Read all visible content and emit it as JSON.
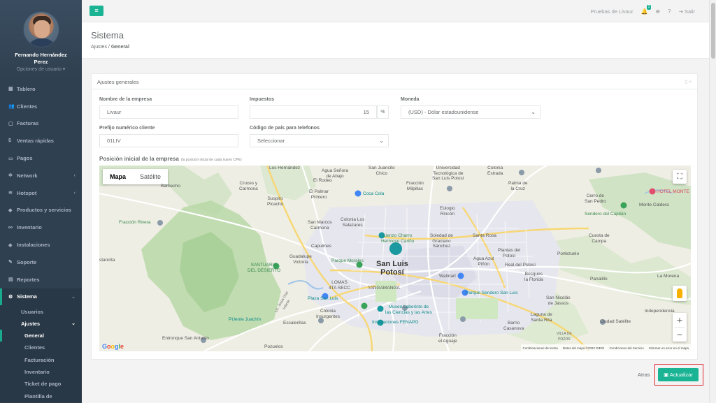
{
  "user": {
    "name": "Fernando Hernández Perez",
    "options_label": "Opciones de usuario ▾"
  },
  "sidebar": {
    "items": [
      {
        "icon": "▦",
        "label": "Tablero",
        "arrow": ""
      },
      {
        "icon": "👥",
        "label": "Clientes",
        "arrow": ""
      },
      {
        "icon": "▢",
        "label": "Facturas",
        "arrow": ""
      },
      {
        "icon": "$",
        "label": "Ventas rápidas",
        "arrow": ""
      },
      {
        "icon": "▭",
        "label": "Pagos",
        "arrow": ""
      },
      {
        "icon": "✲",
        "label": "Network",
        "arrow": "‹"
      },
      {
        "icon": "≋",
        "label": "Hotspot",
        "arrow": "‹"
      },
      {
        "icon": "◆",
        "label": "Productos y servicios",
        "arrow": ""
      },
      {
        "icon": "⚯",
        "label": "Inventario",
        "arrow": ""
      },
      {
        "icon": "◈",
        "label": "Instalaciones",
        "arrow": ""
      },
      {
        "icon": "✎",
        "label": "Soporte",
        "arrow": ""
      },
      {
        "icon": "▤",
        "label": "Reportes",
        "arrow": ""
      }
    ],
    "active": {
      "icon": "⚙",
      "label": "Sistema",
      "arrow": "⌄"
    },
    "sub": [
      "Usuarios",
      "Ajustes",
      "General",
      "Clientes",
      "Facturación",
      "Inventario",
      "Ticket de pago",
      "Plantilla de"
    ],
    "sub_arrow": "⌄"
  },
  "topbar": {
    "menu_icon": "≡",
    "company": "Pruebas de Livaur",
    "badge": "1",
    "logout": "Salir"
  },
  "page": {
    "title": "Sistema",
    "breadcrumb_parent": "Ajustes",
    "breadcrumb_sep": "/",
    "breadcrumb_current": "General"
  },
  "panel": {
    "title": "Ajustes generales",
    "tools": "▯ ×",
    "company_name_label": "Nombre de la empresa",
    "company_name_value": "Livaur",
    "tax_label": "Impuestos",
    "tax_value": "15",
    "tax_unit": "%",
    "currency_label": "Moneda",
    "currency_value": "(USD) - Dólar estadounidense",
    "prefix_label": "Prefijo numérico cliente",
    "prefix_value": "01LIV",
    "country_code_label": "Código de país para telefonos",
    "country_code_value": "Seleccionar",
    "map_title": "Posición inicial de la empresa",
    "map_hint": "(la posicion inicial de cada nuevo CPE)"
  },
  "map": {
    "type_map": "Mapa",
    "type_satellite": "Satélite",
    "fullscreen": "⛶",
    "zoom_in": "+",
    "zoom_out": "−",
    "google": "Google",
    "footer": [
      "Combinaciones de teclas",
      "Datos del mapa ©2022 INEGI",
      "Condiciones del Servicio",
      "Informar un error en el mapa"
    ],
    "labels": [
      "Los Hernández",
      "Agua Señora\nde Abajo",
      "San Juancito\nChico",
      "Universidad\nTecnológica de\nSan Luis Potosí",
      "Colonia\nEstrada",
      "Cruces y\nCarmona",
      "El Palmar\nPrimero",
      "Fracción\nMilpillas",
      "Palma de\nla Cruz",
      "Barbecho",
      "Suspiro\nPicacho",
      "El Rodeo",
      "Coca Cola",
      "HOTEL MONTE",
      "Cerro de\nSan Pedro",
      "Monte Caldera",
      "Eulogio\nRincón",
      "Sendero del Capitán",
      "Fracción Rivera",
      "San Marcos\nCarmona",
      "Colonia Los\nSalazares",
      "Lienzo Charro\nHermoso Cariño",
      "Soledad de\nGraciano\nSánchez",
      "Santa Rosa",
      "Cuesta de\nCampa",
      "Capulines",
      "Plantas del\nPotosí",
      "Portezuelo",
      "stancita",
      "Guadalupe\nVictoria",
      "Parque Morales",
      "San Luis\nPotosí",
      "Agua Azul\nPiñón",
      "SANTUARIO\nDEL DESIERTO",
      "Real del Potosí",
      "La Morena",
      "Walmart",
      "LOMAS\n4TA SECC",
      "TANGAMANGA",
      "Bosques\nla Florida",
      "Panalillo",
      "Parque Sendero San Luis",
      "Plaza San Luis",
      "San Nicolás\nde Jassos",
      "Independencia",
      "Museo Laberinto de\nlas Ciencias y las Artes",
      "Colonia\nInsurgentes",
      "Laguna de\nSanta Rita",
      "Ciudad Satélite",
      "PUente Juachín",
      "Escalerillas",
      "Barrio\nCasanova",
      "Instalaciones FENAPO",
      "Entronque San Antonio",
      "Fracción\nel Aguaje",
      "Pozuelos",
      "Lic. Jesús Díaz\nInfante",
      "VILLA DE\nPOZOS"
    ]
  },
  "actions": {
    "back": "Atras",
    "update_icon": "▣",
    "update": "Actualizar"
  }
}
